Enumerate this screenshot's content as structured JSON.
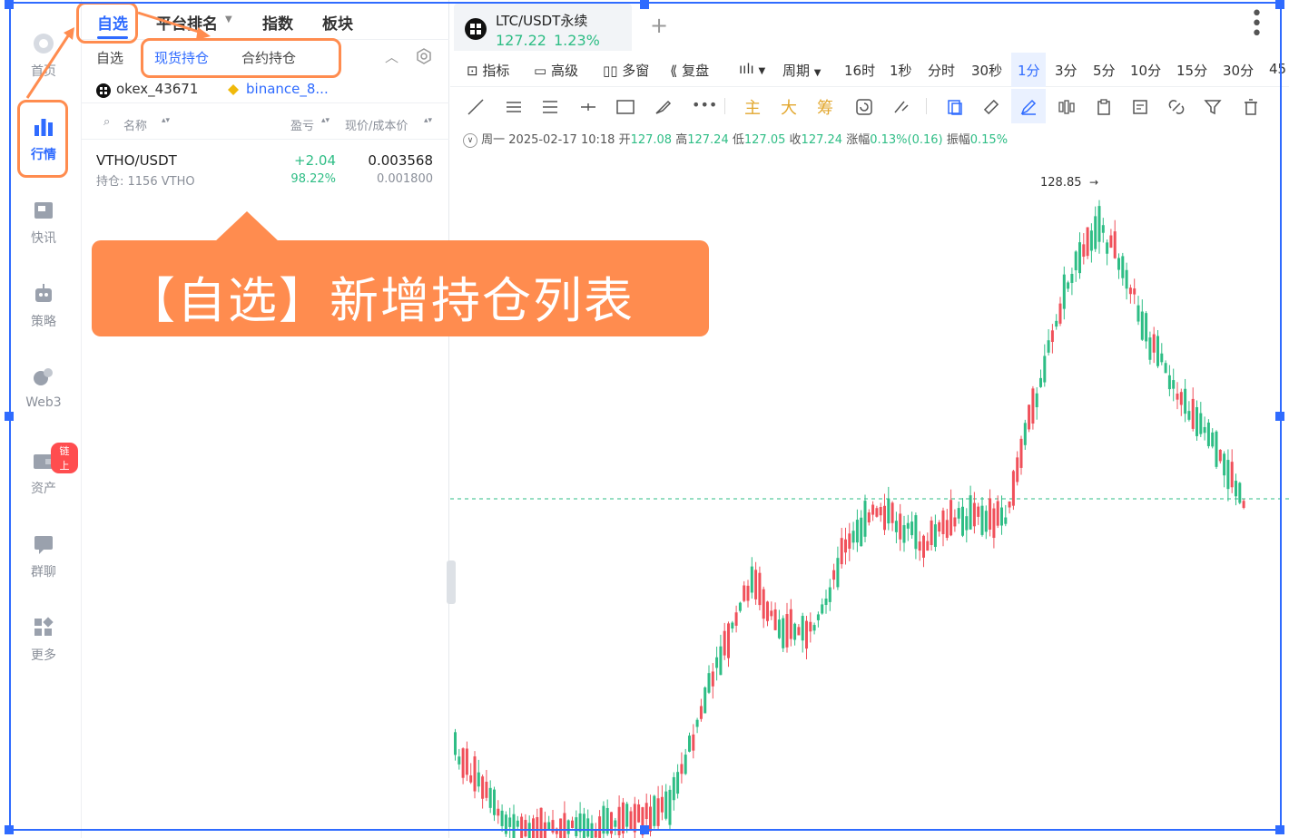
{
  "rail": {
    "items": [
      {
        "name": "home",
        "label": "首页"
      },
      {
        "name": "market",
        "label": "行情"
      },
      {
        "name": "news",
        "label": "快讯"
      },
      {
        "name": "strategy",
        "label": "策略"
      },
      {
        "name": "web3",
        "label": "Web3"
      },
      {
        "name": "assets",
        "label": "资产",
        "badge": "链上"
      },
      {
        "name": "chat",
        "label": "群聊"
      },
      {
        "name": "more",
        "label": "更多"
      }
    ],
    "active": "market"
  },
  "panel": {
    "top_tabs": [
      "自选",
      "平台排名",
      "指数",
      "板块"
    ],
    "sub_tabs": [
      "自选",
      "现货持仓",
      "合约持仓"
    ],
    "accounts": [
      "okex_43671",
      "binance_8..."
    ],
    "columns": {
      "name": "名称",
      "pnl": "盈亏",
      "price": "现价/成本价"
    },
    "rows": [
      {
        "symbol": "VTHO/USDT",
        "holding": "持仓: 1156 VTHO",
        "pnl": "+2.04",
        "pnl_pct": "98.22%",
        "price": "0.003568",
        "cost": "0.001800"
      }
    ]
  },
  "chart": {
    "symbol": "LTC/USDT永续",
    "price": "127.22",
    "change_pct": "1.23%",
    "toolbar": {
      "indicators": "指标",
      "advanced": "高级",
      "multi_window": "多窗",
      "replay": "复盘",
      "period": "周期",
      "intervals": [
        "16时",
        "1秒",
        "分时",
        "30秒",
        "1分",
        "3分",
        "5分",
        "10分",
        "15分",
        "30分",
        "45"
      ],
      "active_interval": "1分"
    },
    "draw_tools": {
      "main": "主",
      "big": "大",
      "chip": "筹"
    },
    "ohlc": {
      "date": "周一 2025-02-17 10:18",
      "open_label": "开",
      "open": "127.08",
      "high_label": "高",
      "high": "127.24",
      "low_label": "低",
      "low": "127.05",
      "close_label": "收",
      "close": "127.24",
      "change_label": "涨幅",
      "change": "0.13%(0.16)",
      "amp_label": "振幅",
      "amp": "0.15%"
    },
    "max_label": "128.85",
    "colors": {
      "up": "#2ebd85",
      "down": "#f0505a",
      "accent": "#2f6bff"
    }
  },
  "callout": {
    "text": "【自选】新增持仓列表"
  }
}
